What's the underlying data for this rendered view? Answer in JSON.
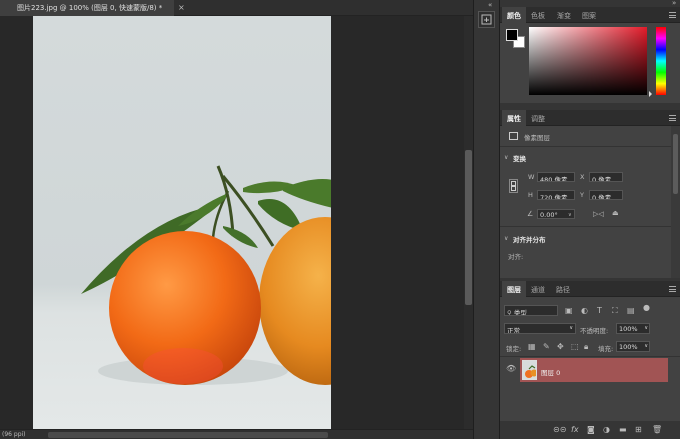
{
  "document": {
    "tab_title": "图片223.jpg @ 100% (图层 0, 快速蒙版/8) *",
    "close_glyph": "×"
  },
  "status": {
    "zoom_readout": "(96 ppi)"
  },
  "dock": {
    "collapse_glyph": "«",
    "history_icon": "history-icon",
    "tools_icon": "brush-settings-icon"
  },
  "color_panel": {
    "tabs": [
      "颜色",
      "色板",
      "渐变",
      "图案"
    ],
    "active_tab": 0,
    "foreground": "#000000",
    "background": "#ffffff"
  },
  "properties_panel": {
    "tabs": [
      "属性",
      "调整"
    ],
    "active_tab": 0,
    "layer_kind": "像素图层",
    "transform": {
      "section_title": "变换",
      "w_label": "W",
      "w_value": "480 像素",
      "x_label": "X",
      "x_value": "0 像素",
      "h_label": "H",
      "h_value": "720 像素",
      "y_label": "Y",
      "y_value": "0 像素",
      "angle_value": "0.00°"
    },
    "align": {
      "section_title": "对齐并分布",
      "align_label": "对齐:"
    }
  },
  "layers_panel": {
    "tabs": [
      "图层",
      "通道",
      "路径"
    ],
    "active_tab": 0,
    "filter_kind": "类型",
    "blend_mode": "正常",
    "opacity_label": "不透明度:",
    "opacity_value": "100%",
    "lock_label": "锁定:",
    "fill_label": "填充:",
    "fill_value": "100%",
    "layer": {
      "name": "图层 0",
      "visible": true,
      "selected_color": "#a15454"
    },
    "footer_icons": [
      "link-icon",
      "fx-icon",
      "mask-icon",
      "adjustment-icon",
      "folder-icon",
      "new-layer-icon",
      "trash-icon"
    ]
  }
}
